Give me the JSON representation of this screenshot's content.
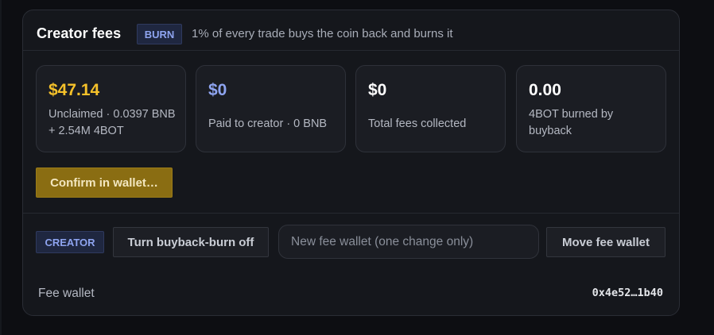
{
  "header": {
    "title": "Creator fees",
    "badge": "BURN",
    "subtitle": "1% of every trade buys the coin back and burns it"
  },
  "stats": [
    {
      "value": "$47.14",
      "label": "Unclaimed · 0.0397 BNB + 2.54M 4BOT",
      "color": "#f5c12a"
    },
    {
      "value": "$0",
      "label": "Paid to creator · 0 BNB",
      "color": "#8ea4f0"
    },
    {
      "value": "$0",
      "label": "Total fees collected",
      "color": "#ffffff"
    },
    {
      "value": "0.00",
      "label": "4BOT burned by buyback",
      "color": "#ffffff"
    }
  ],
  "confirm_button": "Confirm in wallet…",
  "creator": {
    "badge": "CREATOR",
    "toggle_button": "Turn buyback-burn off",
    "fee_wallet_input": {
      "value": "",
      "placeholder": "New fee wallet (one change only)"
    },
    "move_button": "Move fee wallet"
  },
  "fee_wallet": {
    "label": "Fee wallet",
    "address": "0x4e52…1b40"
  }
}
